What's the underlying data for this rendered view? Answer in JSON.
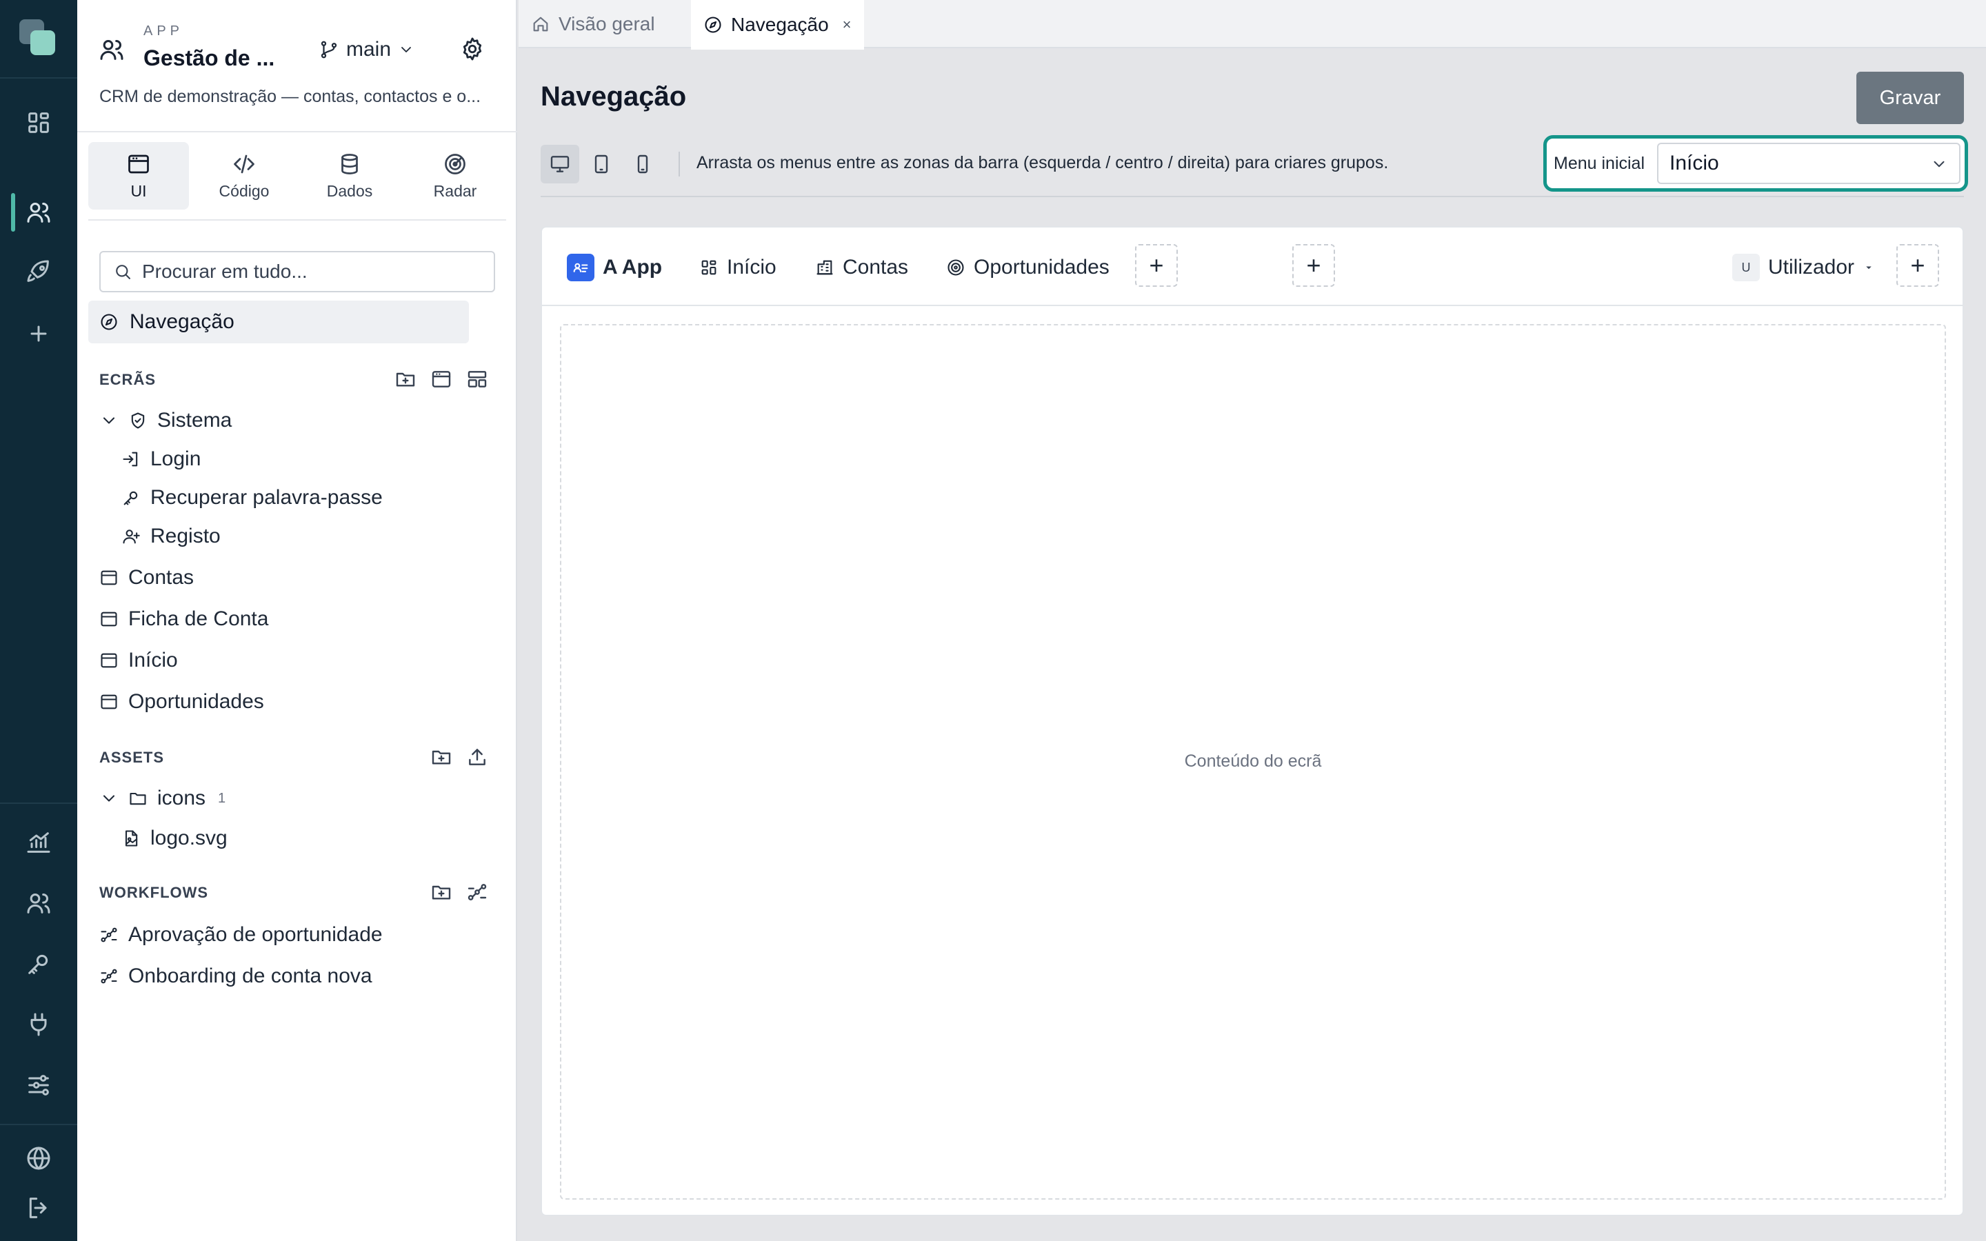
{
  "rail": {
    "top_icons": [
      "dashboard-icon",
      "users-icon",
      "rocket-icon",
      "plus-icon"
    ],
    "bottom_icons": [
      "chart-icon",
      "team-icon",
      "key-icon",
      "plug-icon",
      "sliders-icon",
      "globe-icon",
      "logout-icon"
    ],
    "accent": "#4fb9a8"
  },
  "app": {
    "kicker": "APP",
    "name": "Gestão de ...",
    "branch": "main",
    "description": "CRM de demonstração — contas, contactos e o..."
  },
  "modes": [
    {
      "label": "UI",
      "icon": "window-icon"
    },
    {
      "label": "Código",
      "icon": "code-icon"
    },
    {
      "label": "Dados",
      "icon": "database-icon"
    },
    {
      "label": "Radar",
      "icon": "radar-icon"
    }
  ],
  "search": {
    "placeholder": "Procurar em tudo..."
  },
  "nav_item": {
    "label": "Navegação"
  },
  "screens": {
    "title": "ECRÃS",
    "folder": "Sistema",
    "folder_children": [
      "Login",
      "Recuperar palavra-passe",
      "Registo"
    ],
    "items": [
      "Contas",
      "Ficha de Conta",
      "Início",
      "Oportunidades"
    ]
  },
  "assets": {
    "title": "ASSETS",
    "folder": "icons",
    "folder_count": "1",
    "files": [
      "logo.svg"
    ]
  },
  "workflows": {
    "title": "WORKFLOWS",
    "items": [
      "Aprovação de oportunidade",
      "Onboarding de conta nova"
    ]
  },
  "tabs": [
    {
      "label": "Visão geral",
      "icon": "home-icon"
    },
    {
      "label": "Navegação",
      "icon": "compass-icon",
      "close": "×"
    }
  ],
  "page": {
    "title": "Navegação",
    "save_label": "Gravar",
    "hint": "Arrasta os menus entre as zonas da barra (esquerda / centro / direita) para criares grupos.",
    "start_menu_label": "Menu inicial",
    "start_menu_value": "Início"
  },
  "menubar": {
    "brand": "A App",
    "left_items": [
      "Início",
      "Contas",
      "Oportunidades"
    ],
    "user_initial": "U",
    "user_label": "Utilizador",
    "add": "+"
  },
  "canvas": {
    "placeholder": "Conteúdo do ecrã"
  },
  "colors": {
    "rail_bg": "#0f2a38",
    "highlight": "#14958a",
    "brand_badge": "#3066ea",
    "save_bg": "#6b7680"
  }
}
